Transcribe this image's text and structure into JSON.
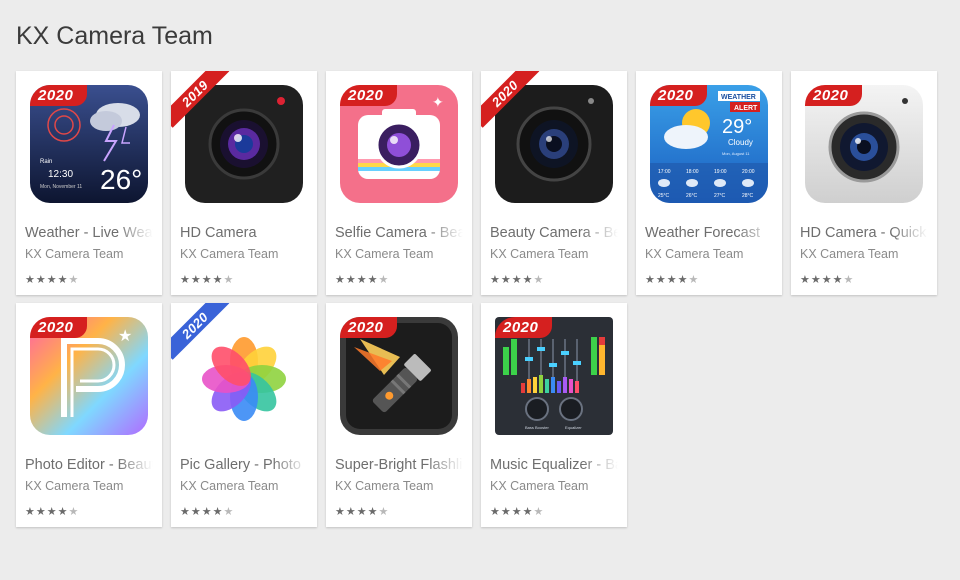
{
  "page": {
    "title": "KX Camera Team"
  },
  "apps": [
    {
      "title": "Weather - Live Weather",
      "developer": "KX Camera Team",
      "badge": "2020",
      "rating": 4.5,
      "icon": "weather-storm-icon",
      "temp": "26°",
      "time": "12:30",
      "label1": "Rain",
      "label2": "Mon, November 11"
    },
    {
      "title": "HD Camera",
      "developer": "KX Camera Team",
      "badge": "2019",
      "rating": 4.5,
      "icon": "camera-lens-icon"
    },
    {
      "title": "Selfie Camera - Beauty",
      "developer": "KX Camera Team",
      "badge": "2020",
      "rating": 4.5,
      "icon": "selfie-camera-icon"
    },
    {
      "title": "Beauty Camera - Beauty",
      "developer": "KX Camera Team",
      "badge": "2020",
      "rating": 4.5,
      "icon": "camera-lens-icon"
    },
    {
      "title": "Weather Forecast",
      "developer": "KX Camera Team",
      "badge": "2020",
      "rating": 4.5,
      "icon": "weather-forecast-icon",
      "temp": "29°",
      "cond": "Cloudy",
      "alert1": "WEATHER",
      "alert2": "ALERT",
      "date": "Mon, August 11",
      "hours": [
        "17:00",
        "18:00",
        "19:00",
        "20:00"
      ],
      "temps": [
        "25°C",
        "26°C",
        "27°C",
        "28°C"
      ]
    },
    {
      "title": "HD Camera - Quick",
      "developer": "KX Camera Team",
      "badge": "2020",
      "rating": 4.5,
      "icon": "camera-lens-icon"
    },
    {
      "title": "Photo Editor - Beauty",
      "developer": "KX Camera Team",
      "badge": "2020",
      "rating": 4.5,
      "icon": "photo-editor-icon"
    },
    {
      "title": "Pic Gallery - Photo",
      "developer": "KX Camera Team",
      "badge": "2020",
      "rating": 4.5,
      "icon": "gallery-flower-icon"
    },
    {
      "title": "Super-Bright Flashlight",
      "developer": "KX Camera Team",
      "badge": "2020",
      "rating": 4.5,
      "icon": "flashlight-icon"
    },
    {
      "title": "Music Equalizer - Bass",
      "developer": "KX Camera Team",
      "badge": "2020",
      "rating": 4.5,
      "icon": "equalizer-icon",
      "lbl_l": "Bass Booster",
      "lbl_r": "Equalizer"
    }
  ],
  "colors": {
    "badge": "#d5201f",
    "background": "#ececec"
  }
}
